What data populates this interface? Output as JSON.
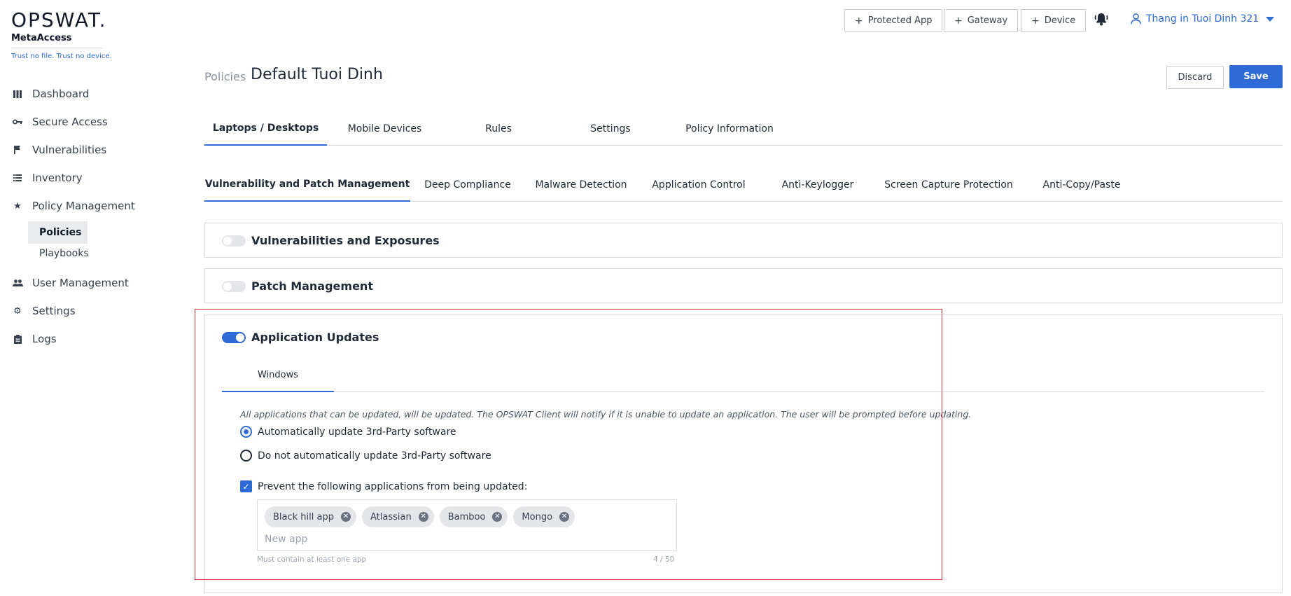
{
  "brand": {
    "logo": "OPSWAT.",
    "product": "MetaAccess",
    "tagline": "Trust no file. Trust no device.",
    "accent": "#2f6bd6"
  },
  "sidebar": {
    "items": [
      {
        "label": "Dashboard",
        "icon": "grid-icon"
      },
      {
        "label": "Secure Access",
        "icon": "key-icon"
      },
      {
        "label": "Vulnerabilities",
        "icon": "flag-icon"
      },
      {
        "label": "Inventory",
        "icon": "list-icon"
      },
      {
        "label": "Policy Management",
        "icon": "star-icon"
      },
      {
        "label": "User Management",
        "icon": "users-icon"
      },
      {
        "label": "Settings",
        "icon": "gear-icon"
      },
      {
        "label": "Logs",
        "icon": "clipboard-icon"
      }
    ],
    "policy_subitems": [
      {
        "label": "Policies",
        "active": true
      },
      {
        "label": "Playbooks",
        "active": false
      }
    ]
  },
  "header": {
    "add_protected_app": "Protected App",
    "add_gateway": "Gateway",
    "add_device": "Device",
    "user_label": "Thang in Tuoi Dinh 321"
  },
  "page": {
    "breadcrumb": "Policies",
    "title": "Default Tuoi Dinh",
    "discard": "Discard",
    "save": "Save"
  },
  "platform_tabs": [
    {
      "label": "Laptops / Desktops",
      "active": true
    },
    {
      "label": "Mobile Devices",
      "active": false
    },
    {
      "label": "Rules",
      "active": false
    },
    {
      "label": "Settings",
      "active": false
    },
    {
      "label": "Policy Information",
      "active": false
    }
  ],
  "feature_tabs": [
    {
      "label": "Vulnerability and Patch Management",
      "active": true
    },
    {
      "label": "Deep Compliance",
      "active": false
    },
    {
      "label": "Malware Detection",
      "active": false
    },
    {
      "label": "Application Control",
      "active": false
    },
    {
      "label": "Anti-Keylogger",
      "active": false
    },
    {
      "label": "Screen Capture Protection",
      "active": false
    },
    {
      "label": "Anti-Copy/Paste",
      "active": false
    }
  ],
  "sections": {
    "vulnerabilities": {
      "title": "Vulnerabilities and Exposures",
      "enabled": false
    },
    "patch": {
      "title": "Patch Management",
      "enabled": false
    },
    "app_updates": {
      "title": "Application Updates",
      "enabled": true,
      "os_tab": "Windows",
      "description": "All applications that can be updated, will be updated. The OPSWAT Client will notify if it is unable to update an application. The user will be prompted before updating.",
      "option_auto": "Automatically update 3rd-Party software",
      "option_manual": "Do not automatically update 3rd-Party software",
      "selected_option": "auto",
      "prevent_label": "Prevent the following applications from being updated:",
      "prevent_checked": true,
      "apps": [
        "Black hill app",
        "Atlassian",
        "Bamboo",
        "Mongo"
      ],
      "new_app_placeholder": "New app",
      "hint": "Must contain at least one app",
      "counter": "4 / 50"
    }
  }
}
